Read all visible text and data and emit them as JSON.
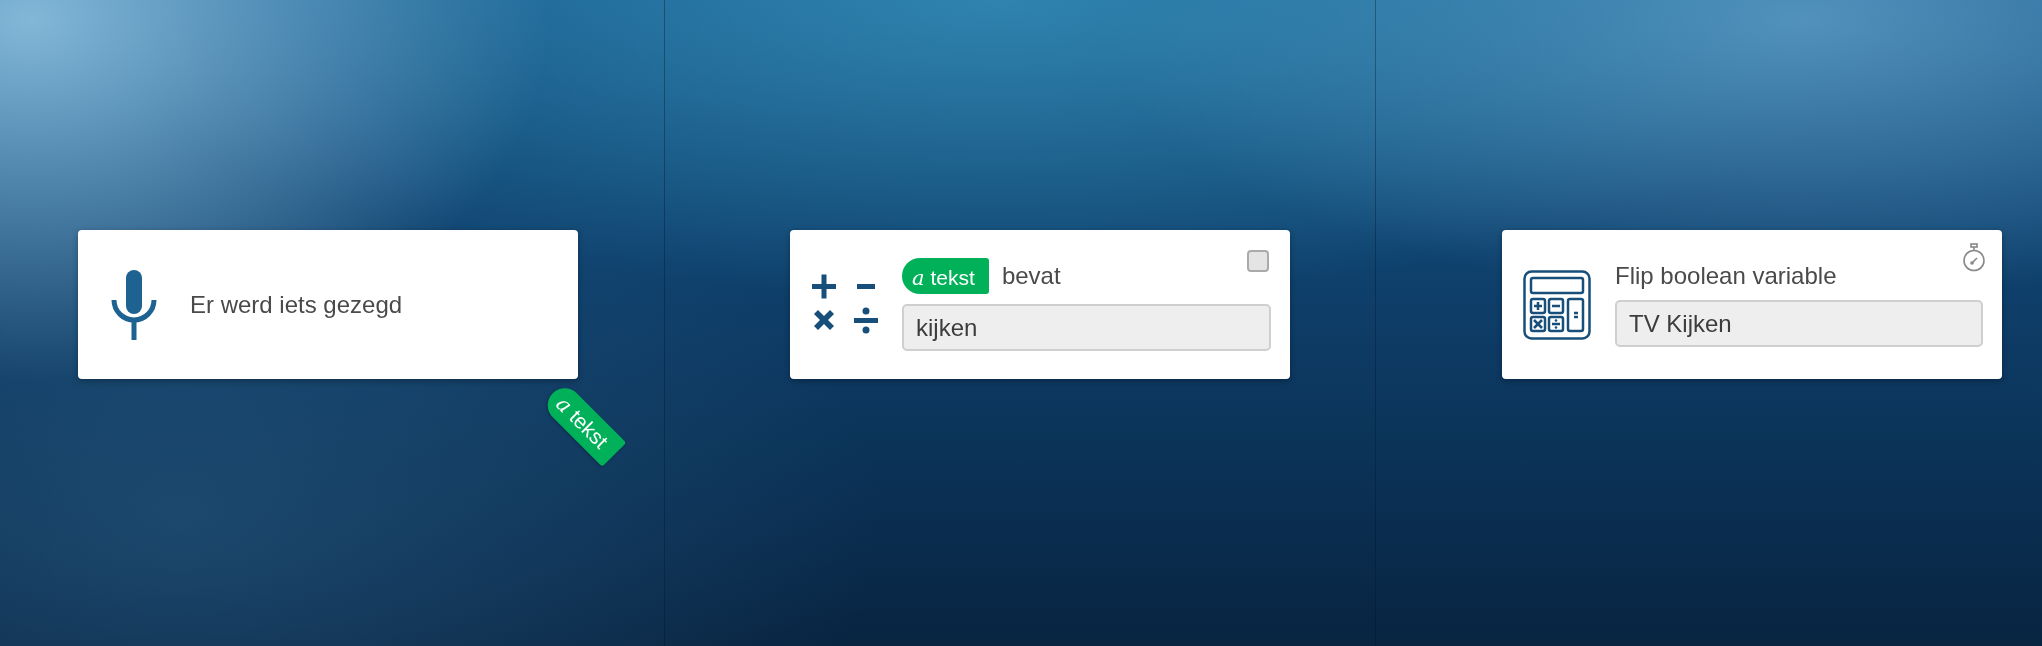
{
  "columns": [
    {
      "card": {
        "kind": "trigger",
        "title": "Er werd iets gezegd",
        "token": {
          "symbol": "a",
          "label": "tekst"
        }
      }
    },
    {
      "card": {
        "kind": "condition",
        "token": {
          "symbol": "a",
          "label": "tekst"
        },
        "label": "bevat",
        "value": "kijken",
        "checkbox": {
          "checked": false
        }
      }
    },
    {
      "card": {
        "kind": "action",
        "title": "Flip boolean variable",
        "value": "TV Kijken"
      }
    }
  ]
}
